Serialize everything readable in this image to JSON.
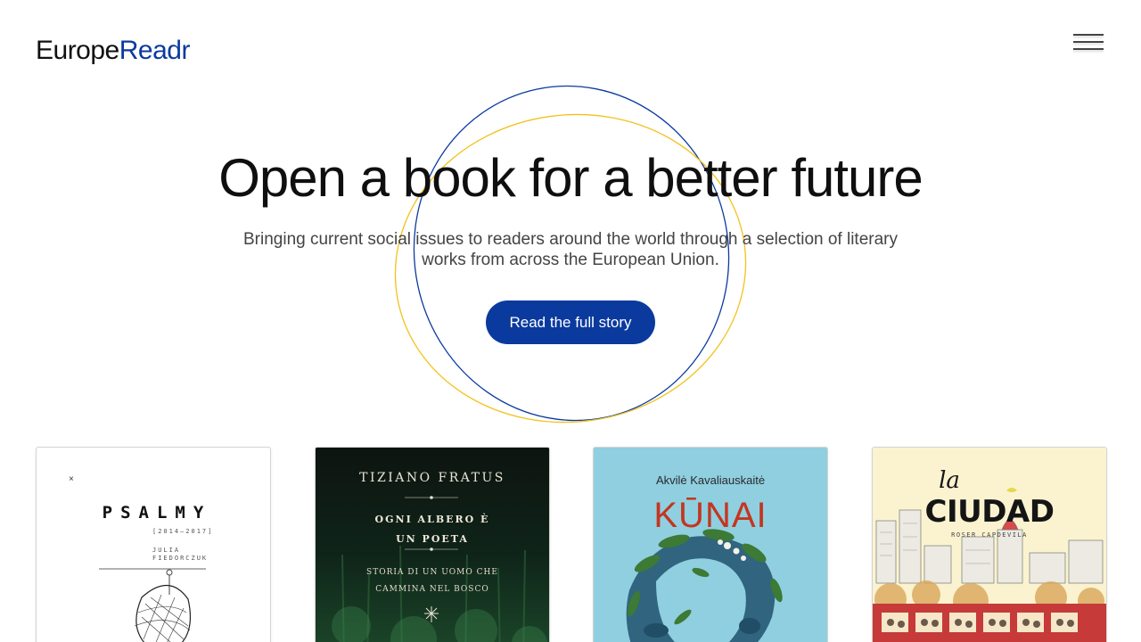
{
  "header": {
    "logo_part1": "Europe",
    "logo_part2": "Readr"
  },
  "hero": {
    "title": "Open a book for a better future",
    "subtitle": "Bringing current social issues to readers around the world through a selection of literary works from across the European Union.",
    "cta_label": "Read the full story"
  },
  "colors": {
    "brand_blue": "#0b3a9f",
    "accent_yellow": "#f2c21a"
  },
  "books": [
    {
      "title": "PSALMY",
      "years": "[2014–2017]",
      "author": "JULIA FIEDORCZUK",
      "mark": "×"
    },
    {
      "author": "TIZIANO FRATUS",
      "title": "OGNI ALBERO È UN POETA",
      "subtitle": "STORIA DI UN UOMO CHE CAMMINA NEL BOSCO"
    },
    {
      "author": "Akvilė Kavaliauskaitė",
      "title": "KŪNAI"
    },
    {
      "title_prefix": "la",
      "title": "CIUDAD",
      "author": "ROSER CAPDEVILA"
    }
  ]
}
